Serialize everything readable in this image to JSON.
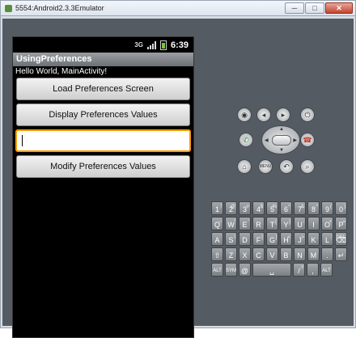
{
  "window": {
    "title": "5554:Android2.3.3Emulator",
    "minimize": "─",
    "maximize": "□",
    "close": "✕"
  },
  "statusbar": {
    "network": "3G",
    "time": "6:39"
  },
  "app": {
    "title": "UsingPreferences",
    "hello": "Hello World, MainActivity!",
    "btn_load": "Load Preferences Screen",
    "btn_display": "Display Preferences Values",
    "input_value": "",
    "btn_modify": "Modify Preferences Values"
  },
  "controls": {
    "camera": "◉",
    "vol_down": "◂",
    "vol_up": "▸",
    "power": "⏻",
    "call": "✆",
    "end": "☎",
    "home": "⌂",
    "menu": "MENU",
    "back": "↶",
    "search": "⌕"
  },
  "keyboard": {
    "row1": [
      {
        "k": "1",
        "s": "!"
      },
      {
        "k": "2",
        "s": "@"
      },
      {
        "k": "3",
        "s": "#"
      },
      {
        "k": "4",
        "s": "$"
      },
      {
        "k": "5",
        "s": "%"
      },
      {
        "k": "6",
        "s": "^"
      },
      {
        "k": "7",
        "s": "&"
      },
      {
        "k": "8",
        "s": "*"
      },
      {
        "k": "9",
        "s": "("
      },
      {
        "k": "0",
        "s": ")"
      }
    ],
    "row2": [
      {
        "k": "Q",
        "s": "~"
      },
      {
        "k": "W",
        "s": "\""
      },
      {
        "k": "E",
        "s": "'"
      },
      {
        "k": "R",
        "s": ""
      },
      {
        "k": "T",
        "s": "{"
      },
      {
        "k": "Y",
        "s": "}"
      },
      {
        "k": "U",
        "s": "-"
      },
      {
        "k": "I",
        "s": ""
      },
      {
        "k": "O",
        "s": "+"
      },
      {
        "k": "P",
        "s": "="
      }
    ],
    "row3": [
      {
        "k": "A",
        "s": ""
      },
      {
        "k": "S",
        "s": "\\"
      },
      {
        "k": "D",
        "s": ""
      },
      {
        "k": "F",
        "s": "["
      },
      {
        "k": "G",
        "s": "]"
      },
      {
        "k": "H",
        "s": "<"
      },
      {
        "k": "J",
        "s": ">"
      },
      {
        "k": "K",
        "s": ";"
      },
      {
        "k": "L",
        "s": ":"
      },
      {
        "k": "⌫",
        "s": "DEL"
      }
    ],
    "row4": [
      {
        "k": "⇧",
        "s": ""
      },
      {
        "k": "Z",
        "s": ""
      },
      {
        "k": "X",
        "s": ""
      },
      {
        "k": "C",
        "s": ""
      },
      {
        "k": "V",
        "s": ""
      },
      {
        "k": "B",
        "s": ""
      },
      {
        "k": "N",
        "s": ""
      },
      {
        "k": "M",
        "s": ""
      },
      {
        "k": ".",
        "s": ""
      },
      {
        "k": "↵",
        "s": ""
      }
    ],
    "row5": [
      {
        "k": "ALT",
        "s": ""
      },
      {
        "k": "SYM",
        "s": ""
      },
      {
        "k": "@",
        "s": ""
      },
      {
        "k": "␣",
        "s": "",
        "space": true
      },
      {
        "k": "/",
        "s": "?"
      },
      {
        "k": ",",
        "s": ""
      },
      {
        "k": "ALT",
        "s": ""
      }
    ]
  }
}
